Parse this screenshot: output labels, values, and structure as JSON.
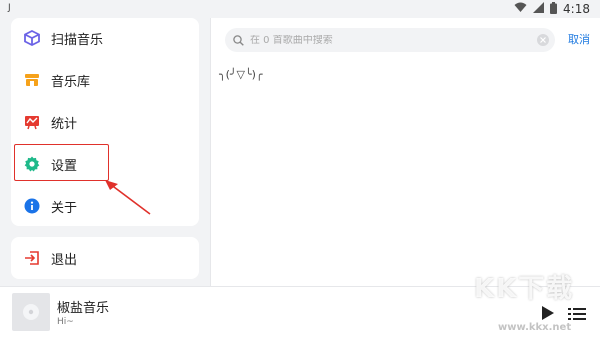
{
  "status": {
    "left_mark": "J",
    "time": "4:18"
  },
  "sidebar": {
    "items": [
      {
        "label": "扫描音乐",
        "icon": "cube-icon",
        "color": "#6b63e6"
      },
      {
        "label": "音乐库",
        "icon": "store-icon",
        "color": "#f6a21a"
      },
      {
        "label": "统计",
        "icon": "chart-board-icon",
        "color": "#e53a30"
      },
      {
        "label": "设置",
        "icon": "gear-icon",
        "color": "#1fb98a"
      },
      {
        "label": "关于",
        "icon": "info-icon",
        "color": "#1a73e8"
      }
    ],
    "logout": {
      "label": "退出",
      "icon": "logout-icon",
      "color": "#e53a30"
    }
  },
  "search": {
    "placeholder": "在 0 首歌曲中搜索",
    "cancel_label": "取消"
  },
  "content": {
    "empty_kaomoji": "╮(╯▽╰)╭"
  },
  "player": {
    "title": "椒盐音乐",
    "subtitle": "Hi~"
  },
  "watermark": {
    "text": "KK下载",
    "url": "www.kkx.net"
  },
  "colors": {
    "accent": "#1f7ae0",
    "highlight": "#e0312b"
  }
}
